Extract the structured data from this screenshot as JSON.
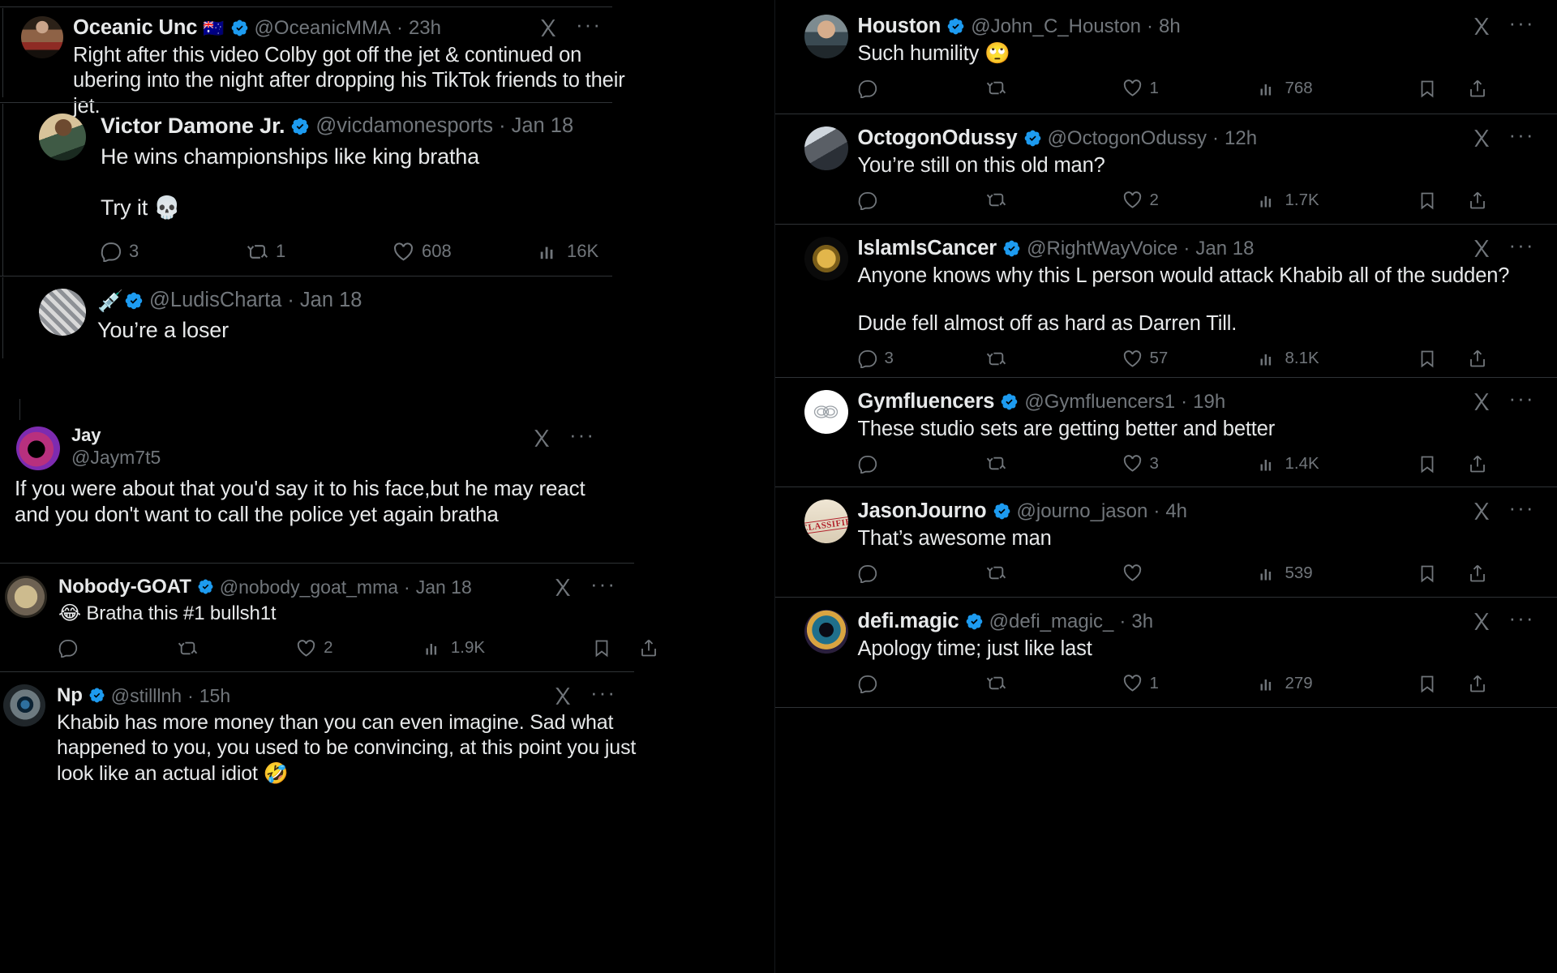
{
  "app": {
    "platform": "X (Twitter)",
    "theme": "dark",
    "accent": "#1d9bf0",
    "text_primary": "#e7e9ea",
    "text_muted": "#71767b",
    "divider": "#2f3336",
    "background": "#000000"
  },
  "icons": {
    "grok": "grok-x-icon",
    "more": "more-options-icon",
    "reply": "reply-icon",
    "retweet": "retweet-icon",
    "like": "like-heart-icon",
    "views": "views-analytics-icon",
    "bookmark": "bookmark-icon",
    "share": "share-icon",
    "verified": "verified-badge-icon",
    "dots_label": "···"
  },
  "left_column": {
    "tweets": [
      {
        "id": "oceanic",
        "display_name": "Oceanic Unc",
        "flag": "🇦🇺",
        "verified": true,
        "handle": "@OceanicMMA",
        "separator": "·",
        "time": "23h",
        "text": "Right after this video Colby got off the jet & continued on ubering into the night after dropping his TikTok friends to their jet.",
        "stats": {
          "reply": "",
          "retweet": "",
          "like": "",
          "views": ""
        }
      },
      {
        "id": "victor",
        "display_name": "Victor Damone Jr.",
        "verified": true,
        "handle": "@vicdamonesports",
        "separator": "·",
        "time": "Jan 18",
        "text_line1": "He wins championships like king bratha",
        "text_line2": "Try it 💀",
        "stats": {
          "reply": "3",
          "retweet": "1",
          "like": "608",
          "views": "16K"
        }
      },
      {
        "id": "ludis",
        "display_name": "",
        "name_emoji": "💉",
        "verified": true,
        "handle": "@LudisCharta",
        "separator": "·",
        "time": "Jan 18",
        "text": "You’re a loser",
        "stats": {
          "reply": "",
          "retweet": "",
          "like": "",
          "views": ""
        }
      },
      {
        "id": "jay",
        "display_name": "Jay",
        "verified": false,
        "handle": "@Jaym7t5",
        "separator": "",
        "time": "",
        "text": "If you were about that you'd say it to his face,but he may react and you don't want to call the police yet again bratha",
        "stats": {
          "reply": "",
          "retweet": "",
          "like": "",
          "views": ""
        }
      },
      {
        "id": "nobodygoat",
        "display_name": "Nobody-GOAT",
        "verified": true,
        "handle": "@nobody_goat_mma",
        "separator": "·",
        "time": "Jan 18",
        "text": "😂 Bratha this #1 bullsh1t",
        "stats": {
          "reply": "",
          "retweet": "",
          "like": "2",
          "views": "1.9K"
        }
      },
      {
        "id": "np",
        "display_name": "Np",
        "verified": true,
        "handle": "@stilllnh",
        "separator": "·",
        "time": "15h",
        "text": "Khabib has more money than you can even imagine. Sad what happened to you, you used to be convincing, at this point you just look like an actual idiot 🤣",
        "stats": {
          "reply": "",
          "retweet": "",
          "like": "",
          "views": ""
        }
      }
    ]
  },
  "right_column": {
    "tweets": [
      {
        "id": "houston",
        "display_name": "Houston",
        "verified": true,
        "handle": "@John_C_Houston",
        "separator": "·",
        "time": "8h",
        "text": "Such humility 🙄",
        "stats": {
          "reply": "",
          "retweet": "",
          "like": "1",
          "views": "768"
        }
      },
      {
        "id": "octogon",
        "display_name": "OctogonOdussy",
        "verified": true,
        "handle": "@OctogonOdussy",
        "separator": "·",
        "time": "12h",
        "text": "You’re still on this old man?",
        "stats": {
          "reply": "",
          "retweet": "",
          "like": "2",
          "views": "1.7K"
        }
      },
      {
        "id": "islamiscancer",
        "display_name": "IslamIsCancer",
        "verified": true,
        "handle": "@RightWayVoice",
        "separator": "·",
        "time": "Jan 18",
        "text_line1": "Anyone knows why this L person would attack Khabib all of the sudden?",
        "text_line2": "Dude fell almost off as hard as Darren Till.",
        "stats": {
          "reply": "3",
          "retweet": "",
          "like": "57",
          "views": "8.1K"
        }
      },
      {
        "id": "gymfluencers",
        "display_name": "Gymfluencers",
        "verified": true,
        "handle": "@Gymfluencers1",
        "separator": "·",
        "time": "19h",
        "text": "These studio sets are getting better and better",
        "stats": {
          "reply": "",
          "retweet": "",
          "like": "3",
          "views": "1.4K"
        }
      },
      {
        "id": "jasonjourno",
        "display_name": "JasonJourno",
        "verified": true,
        "handle": "@journo_jason",
        "separator": "·",
        "time": "4h",
        "text": "That’s awesome man",
        "avatar_stamp": "CLASSIFIED",
        "stats": {
          "reply": "",
          "retweet": "",
          "like": "",
          "views": "539"
        }
      },
      {
        "id": "defimagic",
        "display_name": "defi.magic",
        "verified": true,
        "handle": "@defi_magic_",
        "separator": "·",
        "time": "3h",
        "text": "Apology time; just like last",
        "stats": {
          "reply": "",
          "retweet": "",
          "like": "1",
          "views": "279"
        }
      }
    ]
  }
}
